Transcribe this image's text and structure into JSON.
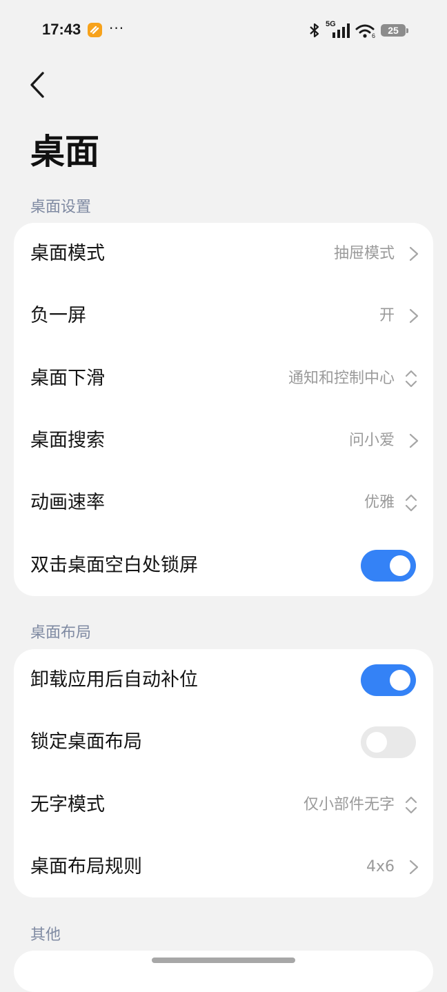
{
  "status_bar": {
    "time": "17:43",
    "more": "···",
    "network": "5G",
    "battery": "25"
  },
  "header": {
    "title": "桌面"
  },
  "sections": [
    {
      "label": "桌面设置",
      "rows": [
        {
          "label": "桌面模式",
          "value": "抽屉模式",
          "control": "chevron"
        },
        {
          "label": "负一屏",
          "value": "开",
          "control": "chevron"
        },
        {
          "label": "桌面下滑",
          "value": "通知和控制中心",
          "control": "updown"
        },
        {
          "label": "桌面搜索",
          "value": "问小爱",
          "control": "chevron"
        },
        {
          "label": "动画速率",
          "value": "优雅",
          "control": "updown"
        },
        {
          "label": "双击桌面空白处锁屏",
          "control": "toggle",
          "on": true
        }
      ]
    },
    {
      "label": "桌面布局",
      "rows": [
        {
          "label": "卸载应用后自动补位",
          "control": "toggle",
          "on": true
        },
        {
          "label": "锁定桌面布局",
          "control": "toggle",
          "on": false
        },
        {
          "label": "无字模式",
          "value": "仅小部件无字",
          "control": "updown"
        },
        {
          "label": "桌面布局规则",
          "value": "4x6",
          "control": "chevron"
        }
      ]
    },
    {
      "label": "其他",
      "rows": []
    }
  ],
  "colors": {
    "accent": "#3482f6",
    "background": "#f2f2f2",
    "section_label": "#7f8aa2",
    "value_text": "#9a9a9a"
  },
  "icons": {
    "back": "chevron-left-icon",
    "chevron": "chevron-right-icon",
    "updown": "chevron-up-down-icon"
  }
}
